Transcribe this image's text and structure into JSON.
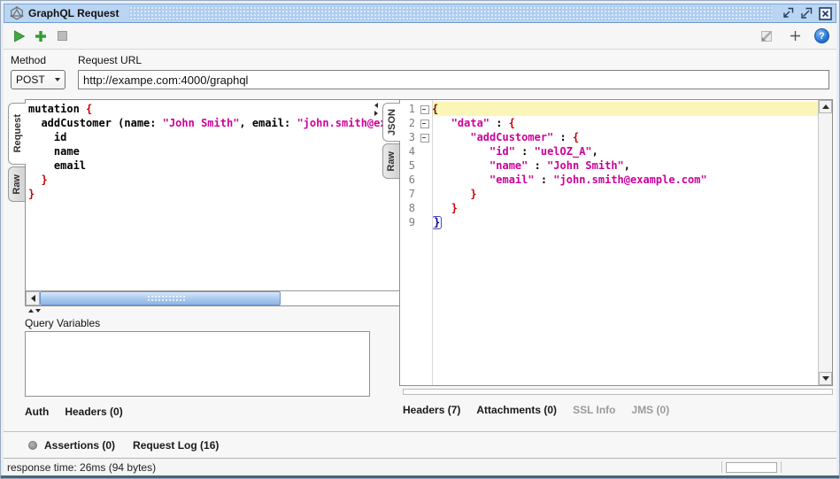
{
  "titlebar": {
    "title": "GraphQL Request"
  },
  "toolbar": {
    "run_icon": "play-icon",
    "add_icon": "plus-icon",
    "stop_icon": "stop-icon",
    "recreate_icon": "recreate-request-icon",
    "add_param_icon": "plus-icon",
    "help_icon": "help-icon"
  },
  "request_bar": {
    "method_label": "Method",
    "url_label": "Request URL",
    "method": "POST",
    "url": "http://exampe.com:4000/graphql"
  },
  "left_pane": {
    "tabs": [
      {
        "label": "Request",
        "active": true
      },
      {
        "label": "Raw",
        "active": false
      }
    ],
    "code": [
      {
        "segs": [
          {
            "t": "mutation ",
            "c": "p"
          },
          {
            "t": "{",
            "c": "b"
          }
        ]
      },
      {
        "segs": [
          {
            "t": "  addCustomer (name: ",
            "c": "p"
          },
          {
            "t": "\"John Smith\"",
            "c": "s"
          },
          {
            "t": ", email: ",
            "c": "p"
          },
          {
            "t": "\"john.smith@example.com\"",
            "c": "s"
          },
          {
            "t": ") {",
            "c": "p"
          }
        ]
      },
      {
        "segs": [
          {
            "t": "    id",
            "c": "p"
          }
        ]
      },
      {
        "segs": [
          {
            "t": "    name",
            "c": "p"
          }
        ]
      },
      {
        "segs": [
          {
            "t": "    email",
            "c": "p"
          }
        ]
      },
      {
        "segs": [
          {
            "t": "  }",
            "c": "b"
          }
        ]
      },
      {
        "segs": [
          {
            "t": "}",
            "c": "b"
          }
        ]
      }
    ],
    "query_variables_label": "Query Variables",
    "bottom_tabs": [
      {
        "label": "Auth"
      },
      {
        "label": "Headers (0)"
      }
    ]
  },
  "right_pane": {
    "tabs": [
      {
        "label": "JSON",
        "active": true
      },
      {
        "label": "Raw",
        "active": false
      }
    ],
    "code": [
      {
        "num": "1",
        "fold": true,
        "hl": true,
        "segs": [
          {
            "t": "{",
            "c": "d"
          }
        ]
      },
      {
        "num": "2",
        "fold": true,
        "segs": [
          {
            "t": "   ",
            "c": "p"
          },
          {
            "t": "\"data\"",
            "c": "s"
          },
          {
            "t": " : ",
            "c": "p"
          },
          {
            "t": "{",
            "c": "b"
          }
        ]
      },
      {
        "num": "3",
        "fold": true,
        "segs": [
          {
            "t": "      ",
            "c": "p"
          },
          {
            "t": "\"addCustomer\"",
            "c": "s"
          },
          {
            "t": " : ",
            "c": "p"
          },
          {
            "t": "{",
            "c": "b"
          }
        ]
      },
      {
        "num": "4",
        "segs": [
          {
            "t": "         ",
            "c": "p"
          },
          {
            "t": "\"id\"",
            "c": "s"
          },
          {
            "t": " : ",
            "c": "p"
          },
          {
            "t": "\"uelOZ_A\"",
            "c": "s"
          },
          {
            "t": ",",
            "c": "p"
          }
        ]
      },
      {
        "num": "5",
        "segs": [
          {
            "t": "         ",
            "c": "p"
          },
          {
            "t": "\"name\"",
            "c": "s"
          },
          {
            "t": " : ",
            "c": "p"
          },
          {
            "t": "\"John Smith\"",
            "c": "s"
          },
          {
            "t": ",",
            "c": "p"
          }
        ]
      },
      {
        "num": "6",
        "segs": [
          {
            "t": "         ",
            "c": "p"
          },
          {
            "t": "\"email\"",
            "c": "s"
          },
          {
            "t": " : ",
            "c": "p"
          },
          {
            "t": "\"john.smith@example.com\"",
            "c": "s"
          }
        ]
      },
      {
        "num": "7",
        "segs": [
          {
            "t": "      ",
            "c": "p"
          },
          {
            "t": "}",
            "c": "b"
          }
        ]
      },
      {
        "num": "8",
        "segs": [
          {
            "t": "   ",
            "c": "p"
          },
          {
            "t": "}",
            "c": "b"
          }
        ]
      },
      {
        "num": "9",
        "segs": [
          {
            "t": "}",
            "c": "m"
          }
        ]
      }
    ],
    "bottom_tabs": [
      {
        "label": "Headers (7)",
        "disabled": false
      },
      {
        "label": "Attachments (0)",
        "disabled": false
      },
      {
        "label": "SSL Info",
        "disabled": true
      },
      {
        "label": "JMS (0)",
        "disabled": true
      }
    ]
  },
  "footer": {
    "assertions_label": "Assertions (0)",
    "request_log_label": "Request Log (16)"
  },
  "statusbar": {
    "text": "response time: 26ms (94 bytes)"
  },
  "colors": {
    "titlebar_blue": "#b9d5f1",
    "string_magenta": "#cc0099",
    "brace_red": "#cc0000",
    "line_highlight_yellow": "#fbf6b7",
    "scrollbar_thumb_blue": "#9dbfe8",
    "run_green": "#44a93e"
  }
}
